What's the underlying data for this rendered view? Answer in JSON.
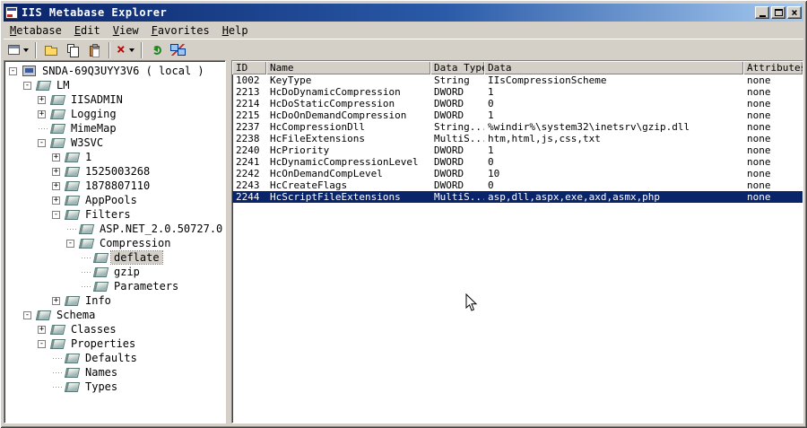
{
  "window": {
    "title": "IIS Metabase Explorer"
  },
  "menu": {
    "items": [
      {
        "label": "Metabase"
      },
      {
        "label": "Edit"
      },
      {
        "label": "View"
      },
      {
        "label": "Favorites"
      },
      {
        "label": "Help"
      }
    ]
  },
  "toolbar": {
    "items": [
      {
        "icon": "tree-view-icon",
        "arrow": true
      },
      {
        "sep": true
      },
      {
        "icon": "new-key-icon"
      },
      {
        "icon": "copy-icon"
      },
      {
        "icon": "paste-icon"
      },
      {
        "sep": true
      },
      {
        "icon": "delete-icon",
        "arrow": true
      },
      {
        "sep": true
      },
      {
        "icon": "refresh-icon"
      },
      {
        "icon": "connect-icon"
      }
    ]
  },
  "tree": {
    "items": [
      {
        "label": "SNDA-69Q3UYY3V6 ( local )",
        "level": 0,
        "expander": "minus",
        "icon": "computer"
      },
      {
        "label": "LM",
        "level": 1,
        "expander": "minus",
        "icon": "db"
      },
      {
        "label": "IISADMIN",
        "level": 2,
        "expander": "plus",
        "icon": "db"
      },
      {
        "label": "Logging",
        "level": 2,
        "expander": "plus",
        "icon": "db"
      },
      {
        "label": "MimeMap",
        "level": 2,
        "expander": "none",
        "icon": "db"
      },
      {
        "label": "W3SVC",
        "level": 2,
        "expander": "minus",
        "icon": "db"
      },
      {
        "label": "1",
        "level": 3,
        "expander": "plus",
        "icon": "db"
      },
      {
        "label": "1525003268",
        "level": 3,
        "expander": "plus",
        "icon": "db"
      },
      {
        "label": "1878807110",
        "level": 3,
        "expander": "plus",
        "icon": "db"
      },
      {
        "label": "AppPools",
        "level": 3,
        "expander": "plus",
        "icon": "db"
      },
      {
        "label": "Filters",
        "level": 3,
        "expander": "minus",
        "icon": "db"
      },
      {
        "label": "ASP.NET_2.0.50727.0",
        "level": 4,
        "expander": "none",
        "icon": "db"
      },
      {
        "label": "Compression",
        "level": 4,
        "expander": "minus",
        "icon": "db"
      },
      {
        "label": "deflate",
        "level": 5,
        "expander": "none",
        "icon": "db",
        "selected": true
      },
      {
        "label": "gzip",
        "level": 5,
        "expander": "none",
        "icon": "db"
      },
      {
        "label": "Parameters",
        "level": 5,
        "expander": "none",
        "icon": "db"
      },
      {
        "label": "Info",
        "level": 3,
        "expander": "plus",
        "icon": "db"
      },
      {
        "label": "Schema",
        "level": 1,
        "expander": "minus",
        "icon": "db"
      },
      {
        "label": "Classes",
        "level": 2,
        "expander": "plus",
        "icon": "db"
      },
      {
        "label": "Properties",
        "level": 2,
        "expander": "minus",
        "icon": "db"
      },
      {
        "label": "Defaults",
        "level": 3,
        "expander": "none",
        "icon": "db"
      },
      {
        "label": "Names",
        "level": 3,
        "expander": "none",
        "icon": "db"
      },
      {
        "label": "Types",
        "level": 3,
        "expander": "none",
        "icon": "db"
      }
    ]
  },
  "table": {
    "columns": [
      "ID",
      "Name",
      "Data Type",
      "Data",
      "Attributes"
    ],
    "rows": [
      [
        "1002",
        "KeyType",
        "String",
        "IIsCompressionScheme",
        "none"
      ],
      [
        "2213",
        "HcDoDynamicCompression",
        "DWORD",
        "1",
        "none"
      ],
      [
        "2214",
        "HcDoStaticCompression",
        "DWORD",
        "0",
        "none"
      ],
      [
        "2215",
        "HcDoOnDemandCompression",
        "DWORD",
        "1",
        "none"
      ],
      [
        "2237",
        "HcCompressionDll",
        "String...",
        "%windir%\\system32\\inetsrv\\gzip.dll",
        "none"
      ],
      [
        "2238",
        "HcFileExtensions",
        "MultiS...",
        "htm,html,js,css,txt",
        "none"
      ],
      [
        "2240",
        "HcPriority",
        "DWORD",
        "1",
        "none"
      ],
      [
        "2241",
        "HcDynamicCompressionLevel",
        "DWORD",
        "0",
        "none"
      ],
      [
        "2242",
        "HcOnDemandCompLevel",
        "DWORD",
        "10",
        "none"
      ],
      [
        "2243",
        "HcCreateFlags",
        "DWORD",
        "0",
        "none"
      ],
      [
        "2244",
        "HcScriptFileExtensions",
        "MultiS...",
        "asp,dll,aspx,exe,axd,asmx,php",
        "none"
      ]
    ],
    "selected_row": "2244"
  },
  "colors": {
    "chrome": "#d4d0c8",
    "titlebar_start": "#0a246a",
    "titlebar_end": "#a6caf0",
    "selection": "#0a246a",
    "selection_text": "#ffffff"
  }
}
